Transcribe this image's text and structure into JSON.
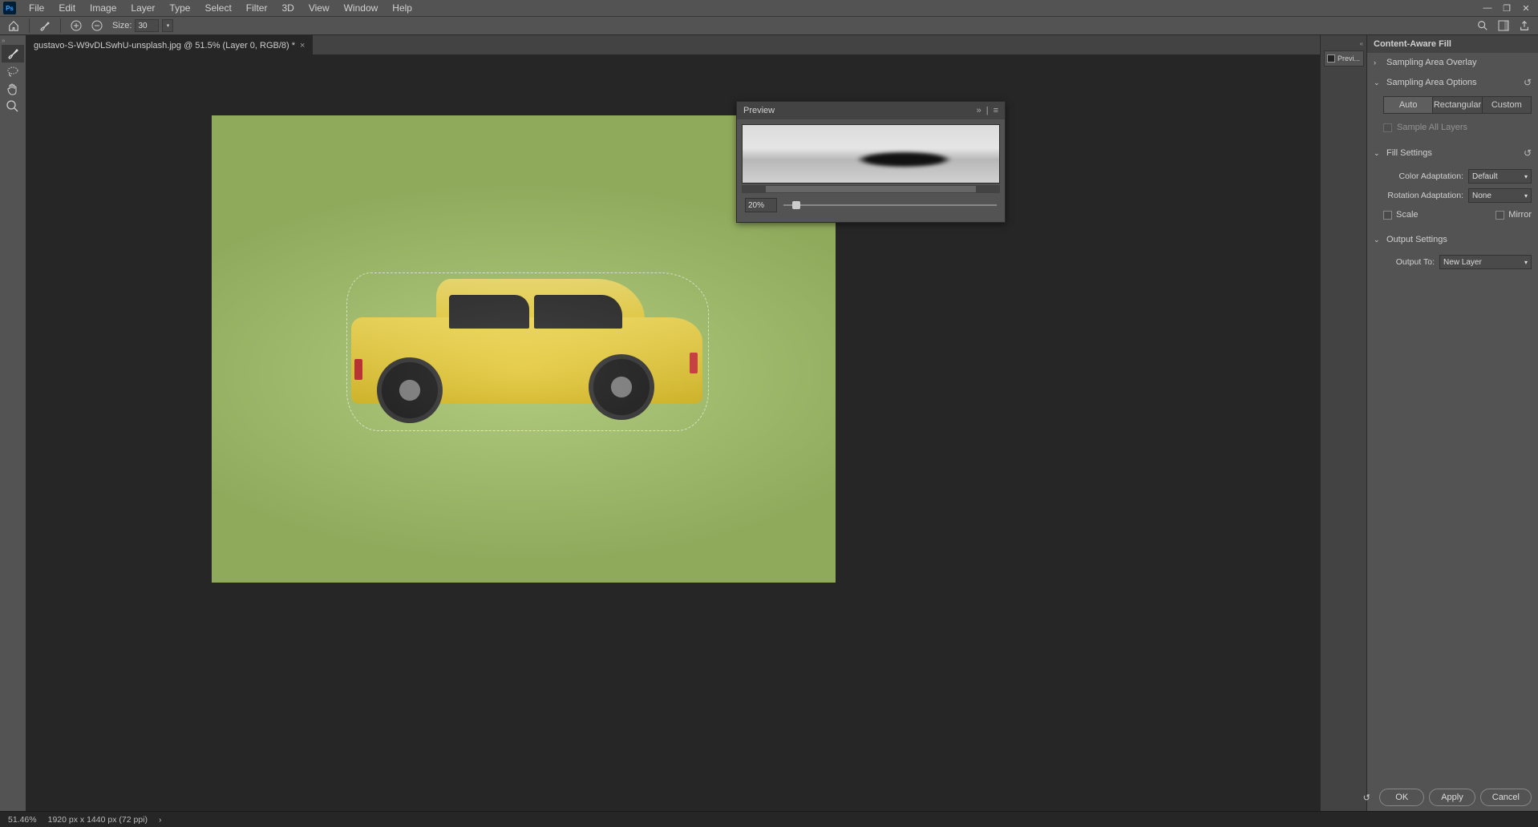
{
  "menubar": {
    "items": [
      "File",
      "Edit",
      "Image",
      "Layer",
      "Type",
      "Select",
      "Filter",
      "3D",
      "View",
      "Window",
      "Help"
    ]
  },
  "toolbar": {
    "size_label": "Size:",
    "size_value": "30"
  },
  "docTab": {
    "title": "gustavo-S-W9vDLSwhU-unsplash.jpg @ 51.5% (Layer 0, RGB/8) *"
  },
  "preview": {
    "title": "Preview",
    "zoom": "20%"
  },
  "rightDock": {
    "btn_label": "Previ..."
  },
  "caf": {
    "title": "Content-Aware Fill",
    "section_overlay": "Sampling Area Overlay",
    "section_options": "Sampling Area Options",
    "seg": {
      "auto": "Auto",
      "rect": "Rectangular",
      "custom": "Custom"
    },
    "sample_all": "Sample All Layers",
    "section_fill": "Fill Settings",
    "color_adapt_label": "Color Adaptation:",
    "color_adapt_value": "Default",
    "rot_adapt_label": "Rotation Adaptation:",
    "rot_adapt_value": "None",
    "scale": "Scale",
    "mirror": "Mirror",
    "section_output": "Output Settings",
    "output_to_label": "Output To:",
    "output_to_value": "New Layer"
  },
  "footer": {
    "ok": "OK",
    "apply": "Apply",
    "cancel": "Cancel"
  },
  "status": {
    "zoom": "51.46%",
    "dims": "1920 px x 1440 px (72 ppi)"
  }
}
